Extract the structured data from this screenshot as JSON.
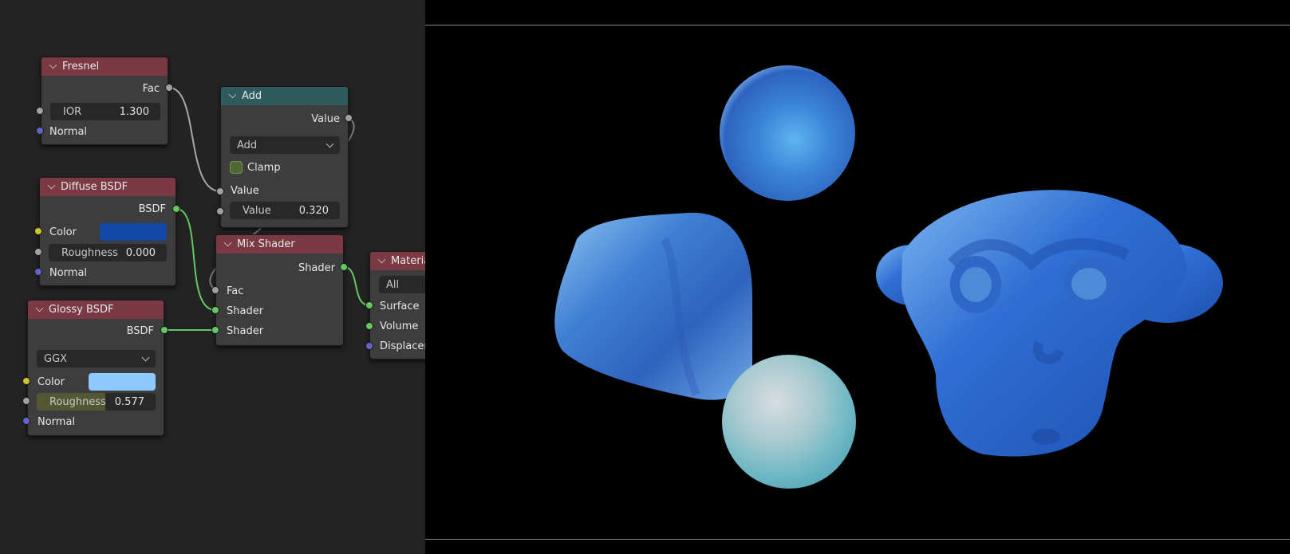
{
  "node_editor": {
    "fresnel": {
      "title": "Fresnel",
      "out_fac": "Fac",
      "ior_label": "IOR",
      "ior_value": "1.300",
      "normal": "Normal"
    },
    "add": {
      "title": "Add",
      "out_value": "Value",
      "operation": "Add",
      "clamp": "Clamp",
      "in_value": "Value",
      "value_label": "Value",
      "value": "0.320"
    },
    "diffuse": {
      "title": "Diffuse BSDF",
      "out_bsdf": "BSDF",
      "color": "Color",
      "color_hex": "#1448a8",
      "roughness_label": "Roughness",
      "roughness": "0.000",
      "normal": "Normal"
    },
    "mix": {
      "title": "Mix Shader",
      "out_shader": "Shader",
      "fac": "Fac",
      "shader1": "Shader",
      "shader2": "Shader"
    },
    "material_output": {
      "title": "Material Output",
      "target": "All",
      "surface": "Surface",
      "volume": "Volume",
      "displacement": "Displacement"
    },
    "glossy": {
      "title": "Glossy BSDF",
      "out_bsdf": "BSDF",
      "distribution": "GGX",
      "color": "Color",
      "color_hex": "#8ecafc",
      "roughness_label": "Roughness",
      "roughness": "0.577",
      "normal": "Normal"
    }
  },
  "viewport": {
    "objects": [
      "sphere-top",
      "rounded-cube",
      "sphere-bottom",
      "monkey-head"
    ],
    "colors": {
      "blue": "#2f6fd4",
      "light_blue": "#8ecafc",
      "cyan": "#62b6c4",
      "background": "#000000"
    }
  }
}
